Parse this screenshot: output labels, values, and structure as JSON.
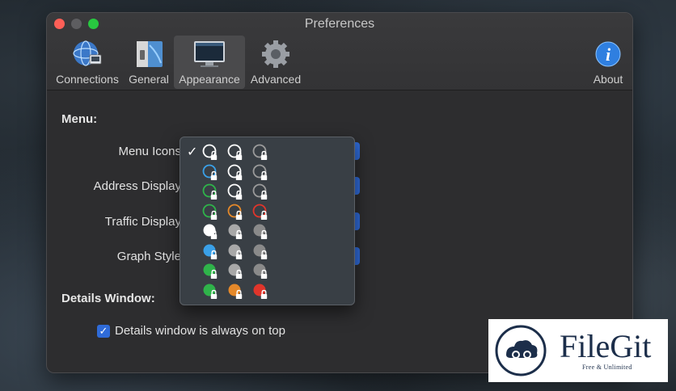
{
  "window": {
    "title": "Preferences"
  },
  "toolbar": {
    "connections": "Connections",
    "general": "General",
    "appearance": "Appearance",
    "advanced": "Advanced",
    "about": "About"
  },
  "menu_section": {
    "title": "Menu:",
    "menu_icons": "Menu Icons",
    "address_display": "Address Display",
    "traffic_display": "Traffic Display",
    "graph_style": "Graph Style"
  },
  "details_section": {
    "title": "Details Window:",
    "always_on_top": "Details window is always on top",
    "always_on_top_checked": true
  },
  "popup": {
    "rows": [
      {
        "selected": true,
        "icons": [
          {
            "style": "ring",
            "color": "#ffffff"
          },
          {
            "style": "ring",
            "color": "#ffffff"
          },
          {
            "style": "ring",
            "color": "#9a9a9a"
          }
        ]
      },
      {
        "selected": false,
        "icons": [
          {
            "style": "ring",
            "color": "#3aa0e8"
          },
          {
            "style": "ring",
            "color": "#ffffff"
          },
          {
            "style": "ring",
            "color": "#9a9a9a"
          }
        ]
      },
      {
        "selected": false,
        "icons": [
          {
            "style": "ring",
            "color": "#2fb34a"
          },
          {
            "style": "ring",
            "color": "#ffffff"
          },
          {
            "style": "ring",
            "color": "#9a9a9a"
          }
        ]
      },
      {
        "selected": false,
        "icons": [
          {
            "style": "ring",
            "color": "#2fb34a"
          },
          {
            "style": "ring",
            "color": "#e5892a"
          },
          {
            "style": "ring",
            "color": "#e0352b"
          }
        ]
      },
      {
        "selected": false,
        "icons": [
          {
            "style": "disc",
            "color": "#ffffff"
          },
          {
            "style": "disc",
            "color": "#a8a8a8"
          },
          {
            "style": "disc",
            "color": "#8a8a8a"
          }
        ]
      },
      {
        "selected": false,
        "icons": [
          {
            "style": "disc",
            "color": "#3aa0e8"
          },
          {
            "style": "disc",
            "color": "#a8a8a8"
          },
          {
            "style": "disc",
            "color": "#8a8a8a"
          }
        ]
      },
      {
        "selected": false,
        "icons": [
          {
            "style": "disc",
            "color": "#2fb34a"
          },
          {
            "style": "disc",
            "color": "#a8a8a8"
          },
          {
            "style": "disc",
            "color": "#8a8a8a"
          }
        ]
      },
      {
        "selected": false,
        "icons": [
          {
            "style": "disc",
            "color": "#2fb34a"
          },
          {
            "style": "disc",
            "color": "#e5892a"
          },
          {
            "style": "disc",
            "color": "#e0352b"
          }
        ]
      }
    ]
  },
  "watermark": {
    "brand": "FileGit",
    "tagline": "Free & Unlimited"
  },
  "colors": {
    "accent": "#2f6bd8",
    "window_bg": "#2d2d2f"
  }
}
